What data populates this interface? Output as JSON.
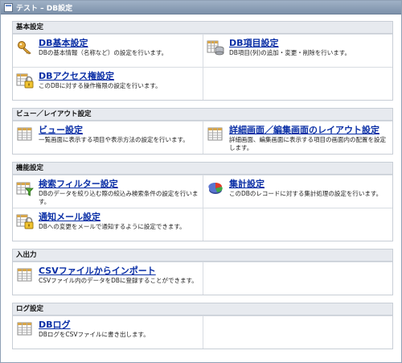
{
  "window": {
    "title": "テスト – DB設定"
  },
  "sections": [
    {
      "header": "基本設定",
      "items": [
        {
          "label": "DB基本設定",
          "desc": "DBの基本情報（名称など）の設定を行います。",
          "icon": "key-icon"
        },
        {
          "label": "DB項目設定",
          "desc": "DB項目(列)の追加・変更・削除を行います。",
          "icon": "db-table-icon"
        },
        {
          "label": "DBアクセス権設定",
          "desc": "このDBに対する操作権限の設定を行います。",
          "icon": "lock-icon"
        }
      ]
    },
    {
      "header": "ビュー／レイアウト設定",
      "items": [
        {
          "label": "ビュー設定",
          "desc": "一覧画面に表示する項目や表示方法の設定を行います。",
          "icon": "grid-icon"
        },
        {
          "label": "詳細画面／編集画面のレイアウト設定",
          "desc": "詳細画面、編集画面に表示する項目の画面内の配置を設定します。",
          "icon": "grid-icon"
        }
      ]
    },
    {
      "header": "機能設定",
      "items": [
        {
          "label": "検索フィルター設定",
          "desc": "DBのデータを絞り込む際の絞込み検索条件の設定を行います。",
          "icon": "filter-grid-icon"
        },
        {
          "label": "集計設定",
          "desc": "このDBのレコードに対する集計処理の設定を行います。",
          "icon": "pie-chart-icon"
        },
        {
          "label": "通知メール設定",
          "desc": "DBへの変更をメールで通知するように設定できます。",
          "icon": "lock-icon"
        }
      ]
    },
    {
      "header": "入出力",
      "items": [
        {
          "label": "CSVファイルからインポート",
          "desc": "CSVファイル内のデータをDBに登録することができます。",
          "icon": "grid-icon"
        }
      ]
    },
    {
      "header": "ログ設定",
      "items": [
        {
          "label": "DBログ",
          "desc": "DBログをCSVファイルに書き出します。",
          "icon": "grid-icon"
        }
      ]
    }
  ]
}
